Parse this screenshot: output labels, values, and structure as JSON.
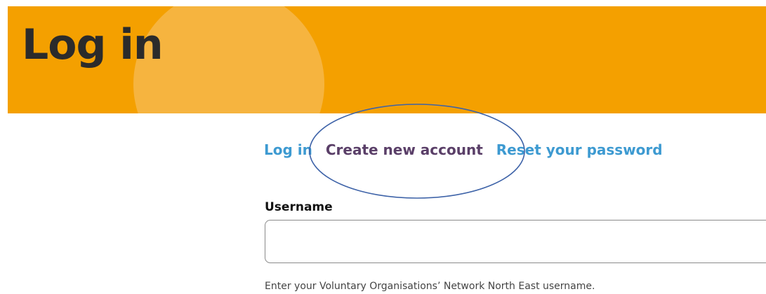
{
  "header": {
    "title": "Log in"
  },
  "tabs": [
    {
      "label": "Log in"
    },
    {
      "label": "Create new account"
    },
    {
      "label": "Reset your password"
    }
  ],
  "form": {
    "username": {
      "label": "Username",
      "value": "",
      "placeholder": "",
      "description": "Enter your Voluntary Organisations’ Network North East username."
    }
  },
  "colors": {
    "hero_background": "#f4a000",
    "hero_circle": "#f6b43f",
    "tab_link": "#3d9ad1",
    "tab_active": "#5a3f68",
    "annotation_stroke": "#3e63a8"
  }
}
